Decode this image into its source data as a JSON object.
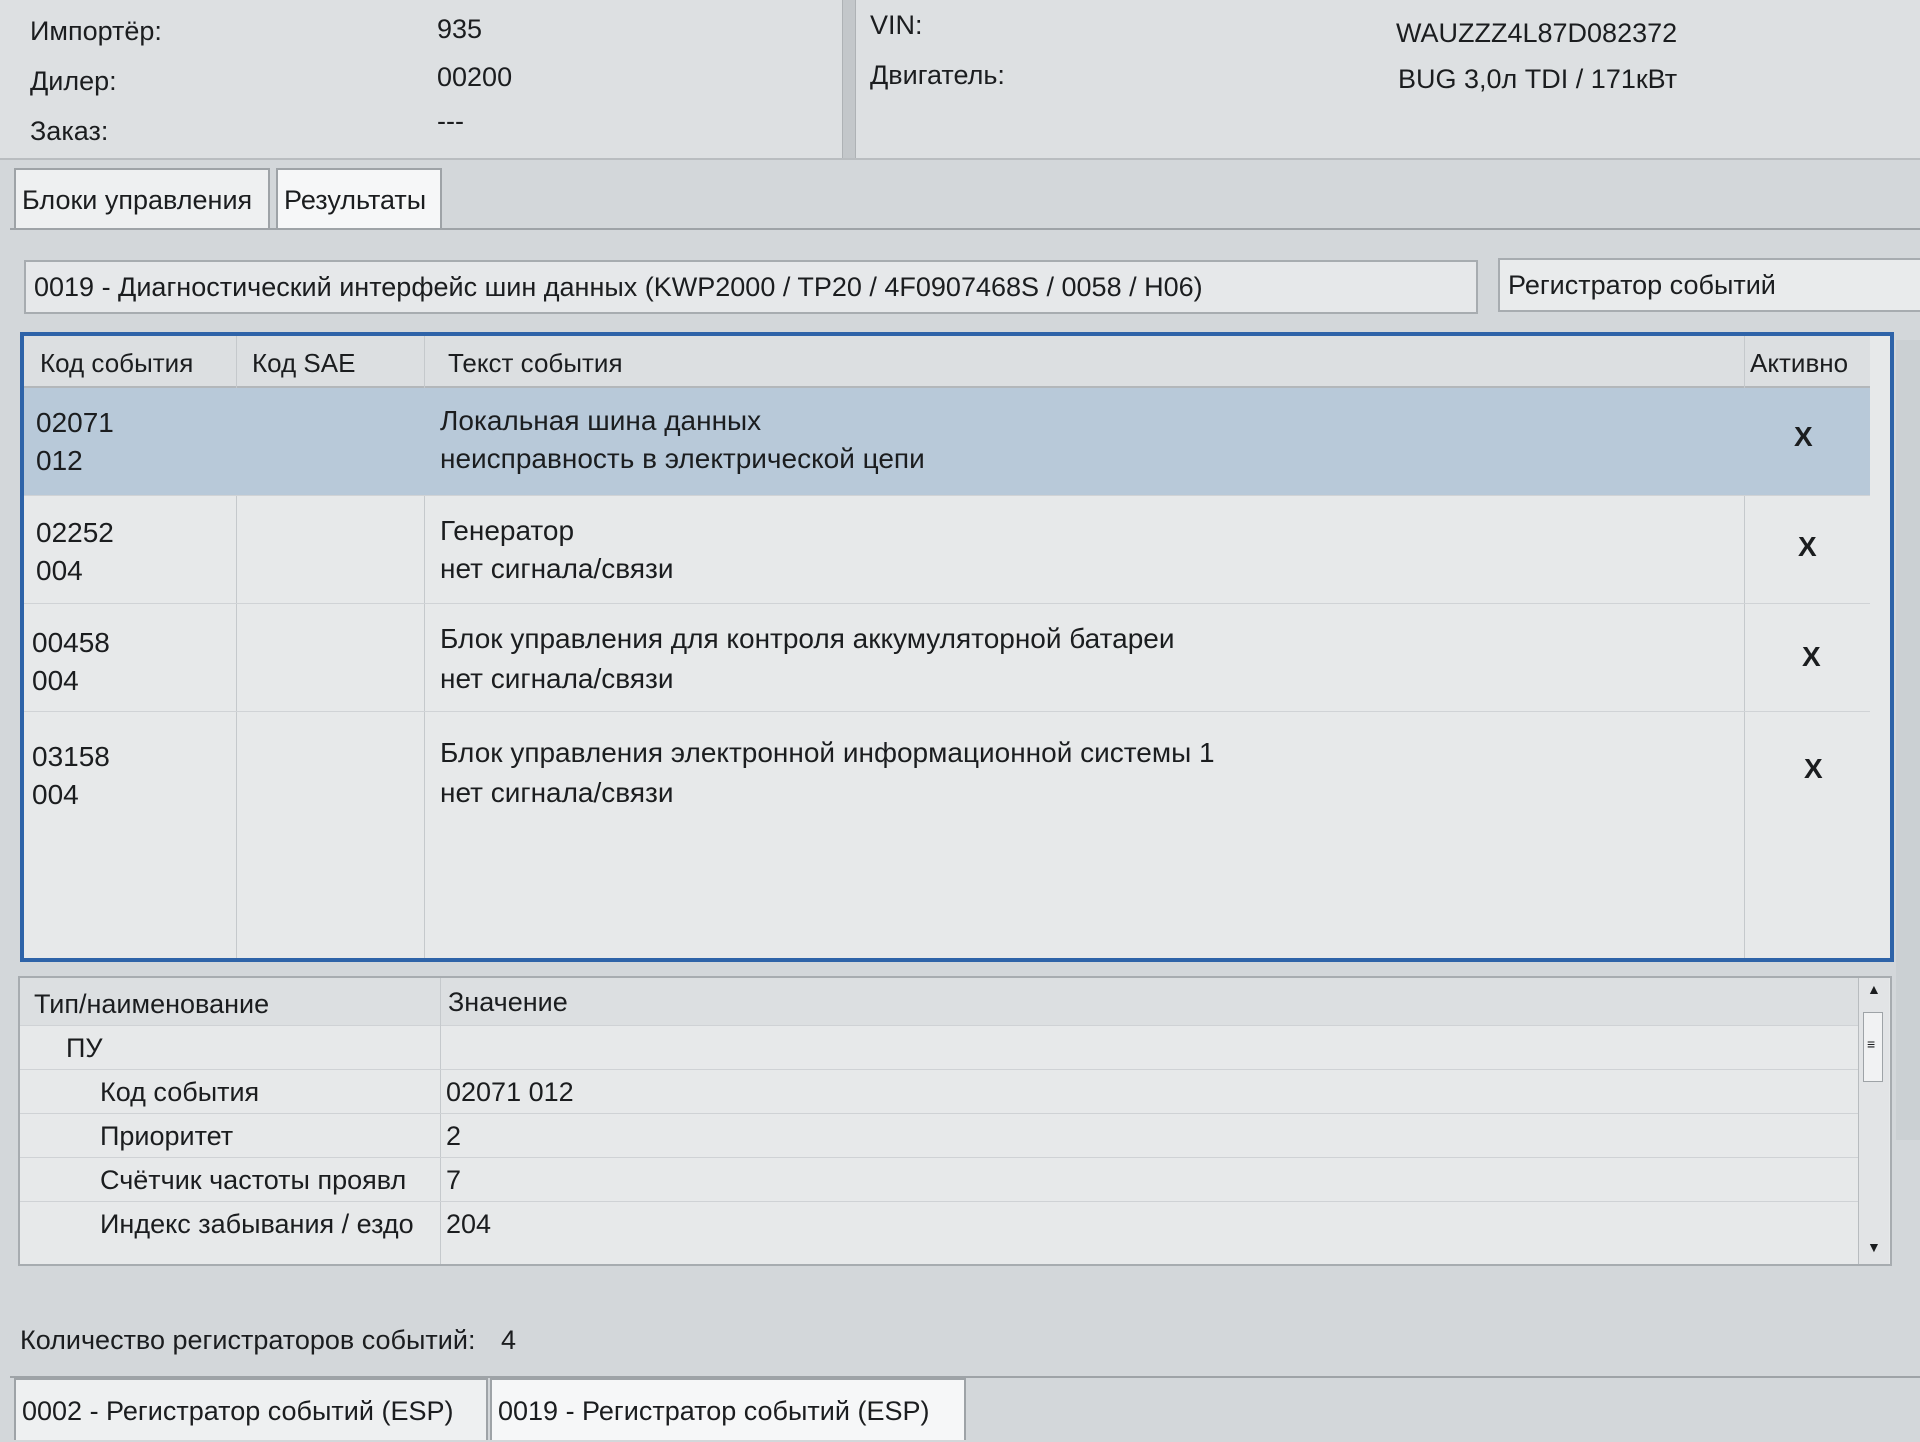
{
  "header": {
    "importer_label": "Импортёр:",
    "importer_value": "935",
    "dealer_label": "Дилер:",
    "dealer_value": "00200",
    "order_label": "Заказ:",
    "order_value": "---",
    "vin_label": "VIN:",
    "vin_value": "WAUZZZ4L87D082372",
    "engine_label": "Двигатель:",
    "engine_value": "BUG 3,0л TDI / 171кВт"
  },
  "tabs": [
    {
      "label": "Блоки управления"
    },
    {
      "label": "Результаты"
    }
  ],
  "control_unit": {
    "selected": "0019 - Диагностический интерфейс шин данных  (KWP2000 / TP20 / 4F0907468S / 0058 / H06)",
    "recorder_button": "Регистратор событий"
  },
  "events": {
    "columns": [
      "Код события",
      "Код SAE",
      "Текст события",
      "Активно"
    ],
    "rows": [
      {
        "code": "02071",
        "sub": "012",
        "sae": "",
        "text": "Локальная шина данных",
        "detail": "неисправность в электрической цепи",
        "active": "X",
        "selected": true
      },
      {
        "code": "02252",
        "sub": "004",
        "sae": "",
        "text": "Генератор",
        "detail": "нет сигнала/связи",
        "active": "X",
        "selected": false
      },
      {
        "code": "00458",
        "sub": "004",
        "sae": "",
        "text": "Блок управления для контроля аккумуляторной батареи",
        "detail": "нет сигнала/связи",
        "active": "X",
        "selected": false
      },
      {
        "code": "03158",
        "sub": "004",
        "sae": "",
        "text": "Блок управления электронной информационной системы 1",
        "detail": "нет сигнала/связи",
        "active": "X",
        "selected": false
      }
    ]
  },
  "details": {
    "columns": [
      "Тип/наименование",
      "Значение"
    ],
    "rows": [
      {
        "name": "ПУ",
        "value": ""
      },
      {
        "name": "Код события",
        "value": "02071 012"
      },
      {
        "name": "Приоритет",
        "value": "2"
      },
      {
        "name": "Счётчик частоты проявл",
        "value": "7"
      },
      {
        "name": "Индекс забывания / ездо",
        "value": "204"
      }
    ]
  },
  "footer": {
    "recorder_count_label": "Количество регистраторов событий:",
    "recorder_count_value": "4",
    "bottom_tabs": [
      {
        "label": "0002 - Регистратор событий (ESP)"
      },
      {
        "label": "0019 - Регистратор событий (ESP)"
      }
    ]
  },
  "colors": {
    "selection": "#b8c9d9",
    "focus_border": "#2e63a8",
    "panel": "#e7e9ea"
  }
}
